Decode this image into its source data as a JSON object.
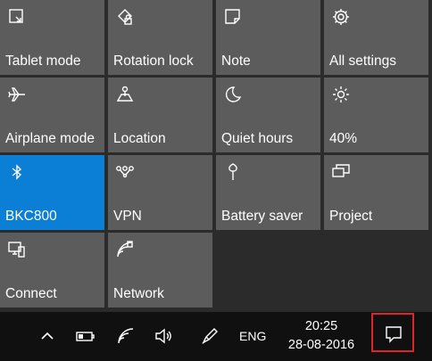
{
  "quick_actions": [
    {
      "label": "Tablet mode",
      "icon": "tablet-mode-icon",
      "active": false
    },
    {
      "label": "Rotation lock",
      "icon": "rotation-lock-icon",
      "active": false
    },
    {
      "label": "Note",
      "icon": "note-icon",
      "active": false
    },
    {
      "label": "All settings",
      "icon": "gear-icon",
      "active": false
    },
    {
      "label": "Airplane mode",
      "icon": "airplane-icon",
      "active": false
    },
    {
      "label": "Location",
      "icon": "location-icon",
      "active": false
    },
    {
      "label": "Quiet hours",
      "icon": "moon-icon",
      "active": false
    },
    {
      "label": "40%",
      "icon": "brightness-icon",
      "active": false
    },
    {
      "label": "BKC800",
      "icon": "bluetooth-icon",
      "active": true
    },
    {
      "label": "VPN",
      "icon": "vpn-icon",
      "active": false
    },
    {
      "label": "Battery saver",
      "icon": "battery-saver-icon",
      "active": false
    },
    {
      "label": "Project",
      "icon": "project-icon",
      "active": false
    },
    {
      "label": "Connect",
      "icon": "connect-icon",
      "active": false
    },
    {
      "label": "Network",
      "icon": "network-icon",
      "active": false
    }
  ],
  "taskbar": {
    "language": "ENG",
    "time": "20:25",
    "date": "28-08-2016",
    "icons": [
      "chevron-up-icon",
      "battery-icon",
      "wifi-icon",
      "volume-icon",
      "pen-icon"
    ]
  },
  "colors": {
    "tile": "#5c5c5c",
    "tile_active": "#0a7fd5",
    "taskbar": "#101010",
    "highlight": "#e0242b"
  }
}
